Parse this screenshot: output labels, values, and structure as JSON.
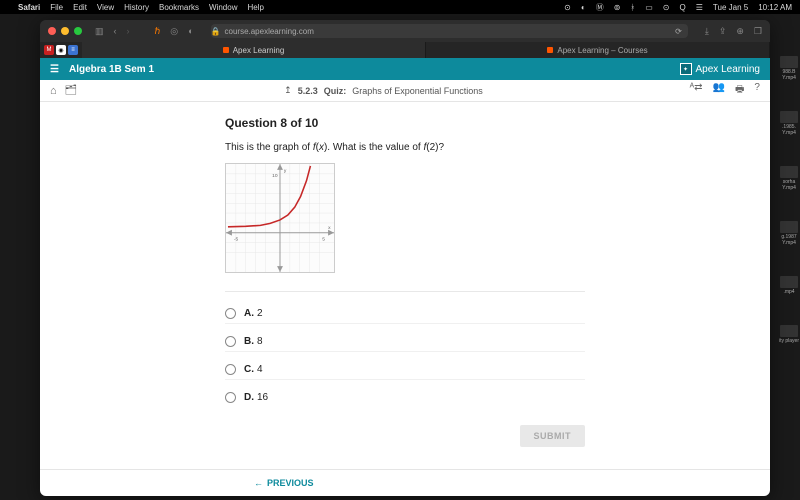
{
  "menubar": {
    "app": "Safari",
    "items": [
      "File",
      "Edit",
      "View",
      "History",
      "Bookmarks",
      "Window",
      "Help"
    ],
    "right": {
      "day": "Tue Jan 5",
      "time": "10:12 AM"
    }
  },
  "browser": {
    "url": "course.apexlearning.com",
    "tabs": [
      {
        "label": "Apex Learning",
        "active": true
      },
      {
        "label": "Apex Learning – Courses",
        "active": false
      }
    ]
  },
  "apex": {
    "course": "Algebra 1B Sem 1",
    "brand": "Apex Learning",
    "breadcrumb_code": "5.2.3",
    "breadcrumb_type": "Quiz:",
    "breadcrumb_title": "Graphs of Exponential Functions"
  },
  "question": {
    "heading": "Question 8 of 10",
    "prompt": "This is the graph of f(x). What is the value of f(2)?",
    "answers": [
      {
        "letter": "A.",
        "text": "2"
      },
      {
        "letter": "B.",
        "text": "8"
      },
      {
        "letter": "C.",
        "text": "4"
      },
      {
        "letter": "D.",
        "text": "16"
      }
    ],
    "submit": "SUBMIT",
    "previous": "PREVIOUS"
  },
  "chart_data": {
    "type": "line",
    "title": "",
    "xlabel": "x",
    "ylabel": "y",
    "xlim": [
      -5,
      5
    ],
    "ylim": [
      -5,
      10
    ],
    "x_ticks": [
      -5,
      5
    ],
    "y_ticks": [
      10
    ],
    "series": [
      {
        "name": "f(x)",
        "x": [
          -5,
          -4,
          -3,
          -2,
          -1,
          0,
          1,
          2,
          2.5,
          3,
          3.3
        ],
        "y": [
          1.03,
          1.06,
          1.13,
          1.25,
          1.5,
          2,
          3,
          5,
          6.7,
          9,
          10.9
        ]
      }
    ],
    "note": "exponential curve passing near (0,2),(1,3),(2,5); y-axis tick at 10, x-axis ticks at -5 and 5"
  },
  "desktop": {
    "files": [
      "988.B Y.mp4",
      ".1985. Y.mp4",
      "sorha Y.mp4",
      "g.1987 Y.mp4",
      ".mp4",
      "ity player"
    ]
  }
}
